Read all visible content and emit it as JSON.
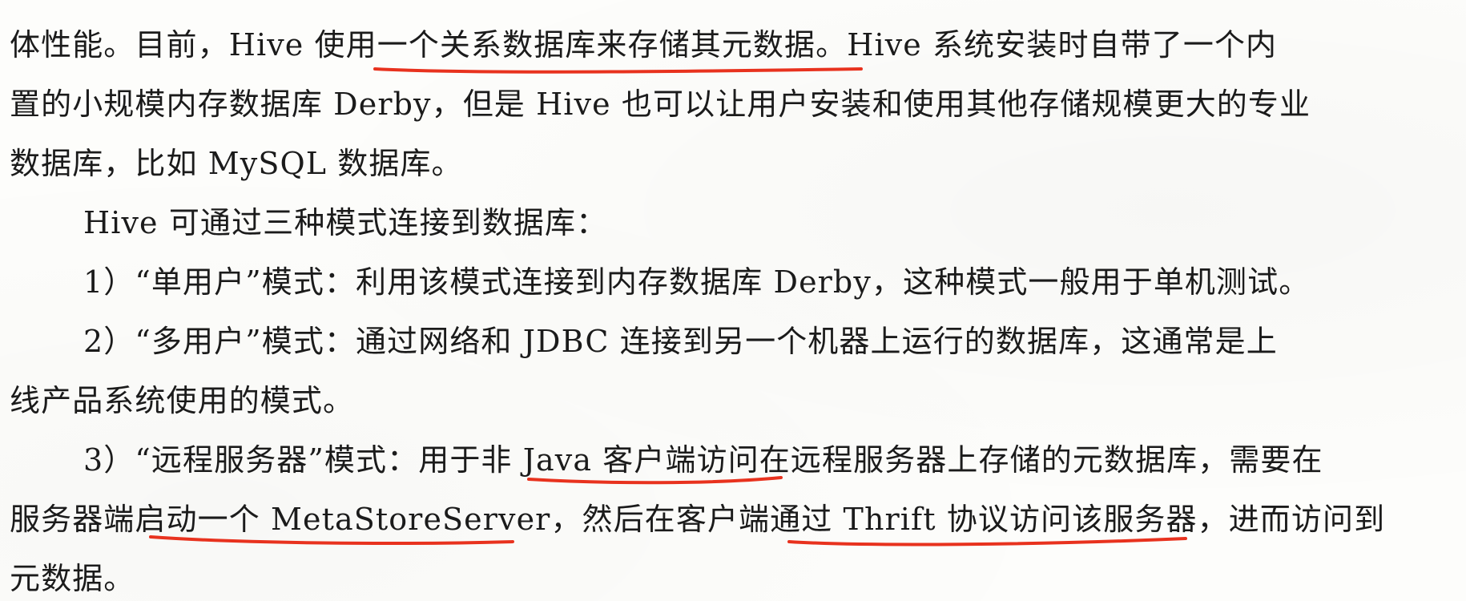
{
  "document": {
    "lines": [
      "体性能。目前，Hive 使用一个关系数据库来存储其元数据。Hive 系统安装时自带了一个内",
      "置的小规模内存数据库 Derby，但是 Hive 也可以让用户安装和使用其他存储规模更大的专业",
      "数据库，比如 MySQL 数据库。",
      "Hive 可通过三种模式连接到数据库：",
      "1）“单用户”模式：利用该模式连接到内存数据库 Derby，这种模式一般用于单机测试。",
      "2）“多用户”模式：通过网络和 JDBC 连接到另一个机器上运行的数据库，这通常是上",
      "线产品系统使用的模式。",
      "3）“远程服务器”模式：用于非 Java 客户端访问在远程服务器上存储的元数据库，需要在",
      "服务器端启动一个 MetaStoreServer，然后在客户端通过 Thrift 协议访问该服务器，进而访问到",
      "元数据。"
    ]
  },
  "annotation_color": "#e8321e"
}
